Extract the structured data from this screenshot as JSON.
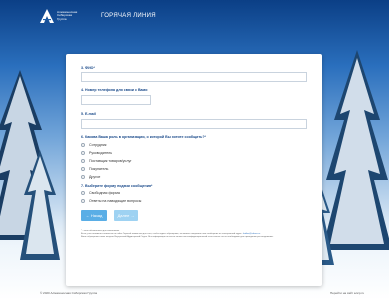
{
  "header": {
    "logo_lines": [
      "Алмазоносная",
      "Сибирская",
      "Группа"
    ],
    "hotline_title": "ГОРЯЧАЯ ЛИНИЯ"
  },
  "form": {
    "q3": "3. ФИО*",
    "q4": "4. Номер телефона для связи с Вами",
    "q5": "5. E-mail",
    "q6": "6. Какова Ваша роль в организации, о которой Вы хотите сообщить?*",
    "roles": [
      "Сотрудник",
      "Руководитель",
      "Поставщик товаров/услуг",
      "Покупатель",
      "Другое"
    ],
    "q7": "7. Выберите форму подачи сообщения*",
    "forms": [
      "Свободная форма",
      "Ответы на наводящие вопросы"
    ],
    "back_label": "← Назад",
    "next_label": "Далее →",
    "note_line1": "* - поля обязательны для заполнения",
    "note_line2": "Если у вас возникли сложности на сайте Горячей линии или для того, чтобы подать обращение, вы можете направить нам сообщение на электронный адрес:",
    "note_email": "hotline@alrosa.ru",
    "note_line3": "Ваше обращение также получит Внутренний Аудиторский Отдел. Вся информация остается полностью конфиденциальной если только это не необходимо для проведения расследования."
  },
  "footer": {
    "copyright": "© 2020 Алмазоносная Сибирская Группа",
    "right_link": "Перейти на сайт алср.ru"
  }
}
